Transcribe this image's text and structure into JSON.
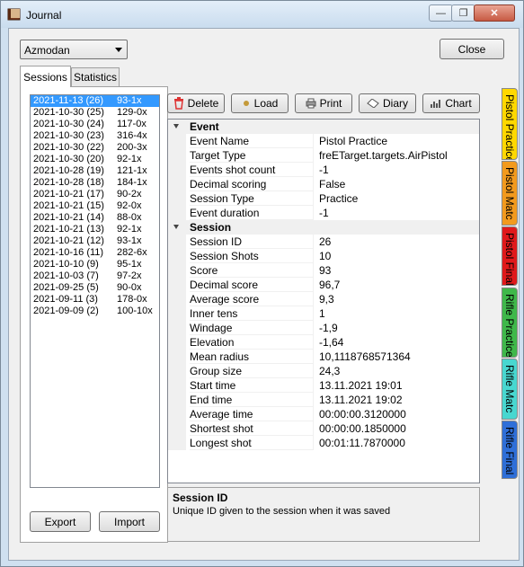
{
  "window": {
    "title": "Journal"
  },
  "header": {
    "player_select": "Azmodan",
    "close_label": "Close"
  },
  "tabs": [
    {
      "label": "Sessions",
      "active": true
    },
    {
      "label": "Statistics",
      "active": false
    }
  ],
  "sessions": [
    {
      "date": "2021-11-13 (26)",
      "score": "93-1x",
      "selected": true
    },
    {
      "date": "2021-10-30 (25)",
      "score": "129-0x"
    },
    {
      "date": "2021-10-30 (24)",
      "score": "117-0x"
    },
    {
      "date": "2021-10-30 (23)",
      "score": "316-4x"
    },
    {
      "date": "2021-10-30 (22)",
      "score": "200-3x"
    },
    {
      "date": "2021-10-30 (20)",
      "score": "92-1x"
    },
    {
      "date": "2021-10-28 (19)",
      "score": "121-1x"
    },
    {
      "date": "2021-10-28 (18)",
      "score": "184-1x"
    },
    {
      "date": "2021-10-21 (17)",
      "score": "90-2x"
    },
    {
      "date": "2021-10-21 (15)",
      "score": "92-0x"
    },
    {
      "date": "2021-10-21 (14)",
      "score": "88-0x"
    },
    {
      "date": "2021-10-21 (13)",
      "score": "92-1x"
    },
    {
      "date": "2021-10-21 (12)",
      "score": "93-1x"
    },
    {
      "date": "2021-10-16 (11)",
      "score": "282-6x"
    },
    {
      "date": "2021-10-10 (9)",
      "score": "95-1x"
    },
    {
      "date": "2021-10-03 (7)",
      "score": "97-2x"
    },
    {
      "date": "2021-09-25 (5)",
      "score": "90-0x"
    },
    {
      "date": "2021-09-11 (3)",
      "score": "178-0x"
    },
    {
      "date": "2021-09-09 (2)",
      "score": "100-10x"
    }
  ],
  "list_buttons": {
    "export": "Export",
    "import": "Import"
  },
  "toolbar": {
    "delete": "Delete",
    "load": "Load",
    "print": "Print",
    "diary": "Diary",
    "chart": "Chart"
  },
  "properties": {
    "event": {
      "title": "Event",
      "rows": [
        {
          "k": "Event Name",
          "v": "Pistol Practice"
        },
        {
          "k": "Target Type",
          "v": "freETarget.targets.AirPistol"
        },
        {
          "k": "Events shot count",
          "v": "-1"
        },
        {
          "k": "Decimal scoring",
          "v": "False"
        },
        {
          "k": "Session Type",
          "v": "Practice"
        },
        {
          "k": "Event duration",
          "v": "-1"
        }
      ]
    },
    "session": {
      "title": "Session",
      "rows": [
        {
          "k": "Session ID",
          "v": "26"
        },
        {
          "k": "Session Shots",
          "v": "10"
        },
        {
          "k": "Score",
          "v": "93"
        },
        {
          "k": "Decimal score",
          "v": "96,7"
        },
        {
          "k": "Average score",
          "v": "9,3"
        },
        {
          "k": "Inner tens",
          "v": "1"
        },
        {
          "k": "Windage",
          "v": "-1,9"
        },
        {
          "k": "Elevation",
          "v": "-1,64"
        },
        {
          "k": "Mean radius",
          "v": "10,1118768571364"
        },
        {
          "k": "Group size",
          "v": "24,3"
        },
        {
          "k": "Start time",
          "v": "13.11.2021 19:01"
        },
        {
          "k": "End time",
          "v": "13.11.2021 19:02"
        },
        {
          "k": "Average time",
          "v": "00:00:00.3120000"
        },
        {
          "k": "Shortest shot",
          "v": "00:00:00.1850000"
        },
        {
          "k": "Longest shot",
          "v": "00:01:11.7870000"
        }
      ]
    }
  },
  "help": {
    "title": "Session ID",
    "text": "Unique ID given to the session when it was saved"
  },
  "side_tabs": [
    {
      "label": "Pistol Practice",
      "color": "#ffd800"
    },
    {
      "label": "Pistol Matc",
      "color": "#f29a1e"
    },
    {
      "label": "Pistol Final",
      "color": "#e0191b"
    },
    {
      "label": "Rifle Practice",
      "color": "#3fb84a"
    },
    {
      "label": "Rifle Matc",
      "color": "#48d7d0"
    },
    {
      "label": "Rifle Final",
      "color": "#2f6fd8"
    }
  ]
}
